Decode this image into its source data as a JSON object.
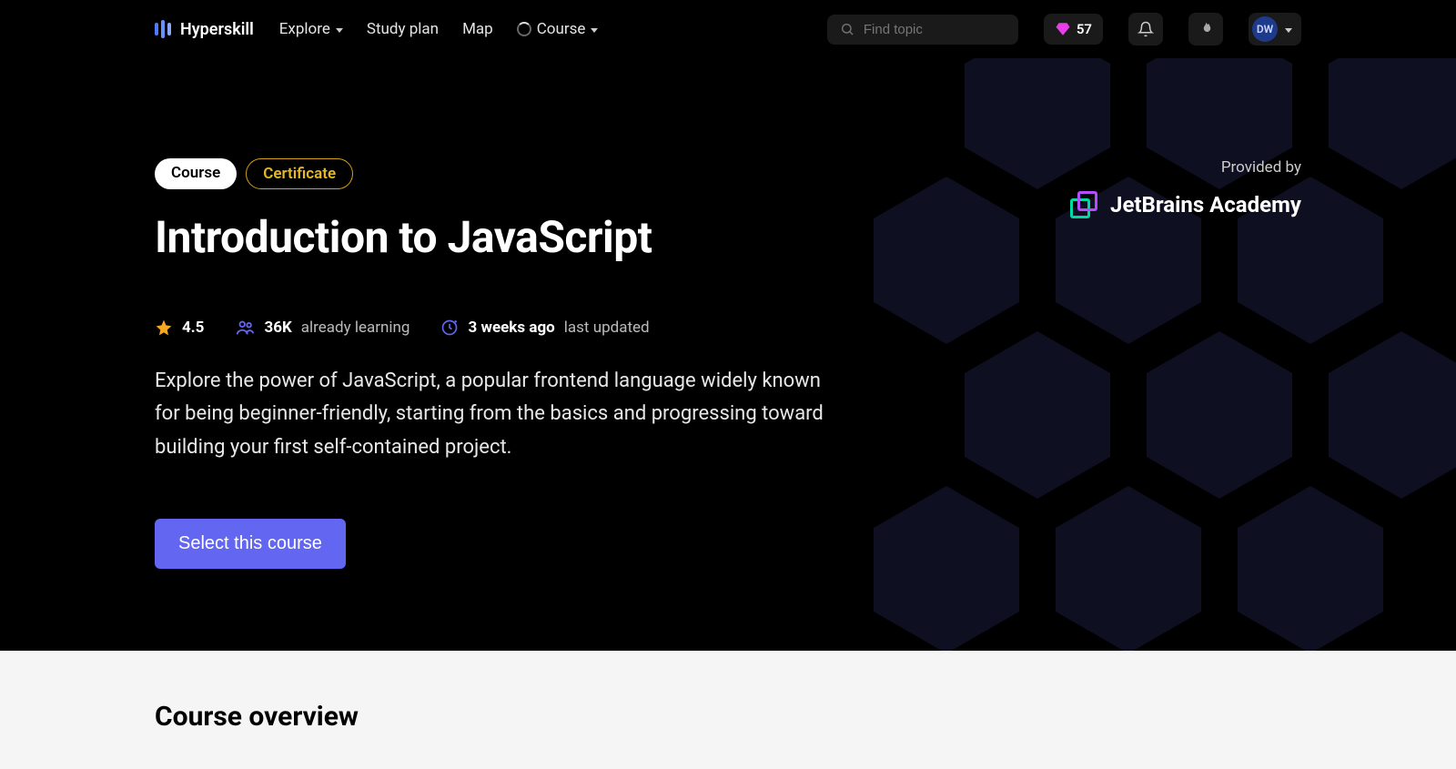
{
  "header": {
    "brand": "Hyperskill",
    "nav": {
      "explore": "Explore",
      "study_plan": "Study plan",
      "map": "Map",
      "course": "Course"
    },
    "search": {
      "placeholder": "Find topic"
    },
    "gems": "57",
    "avatar_initials": "DW"
  },
  "hero": {
    "badge_course": "Course",
    "badge_cert": "Certificate",
    "title": "Introduction to JavaScript",
    "rating": "4.5",
    "learners_count": "36K",
    "learners_label": "already learning",
    "updated_value": "3 weeks ago",
    "updated_label": "last updated",
    "description": "Explore the power of JavaScript, a popular frontend language widely known for being beginner-friendly, starting from the basics and progressing toward building your first self-contained project.",
    "cta": "Select this course",
    "provider_label": "Provided by",
    "provider_name": "JetBrains Academy"
  },
  "overview": {
    "heading": "Course overview"
  },
  "colors": {
    "accent": "#6366f1",
    "gem": "#e83ee8",
    "star": "#f5a623",
    "cert_border": "#d4a017"
  }
}
